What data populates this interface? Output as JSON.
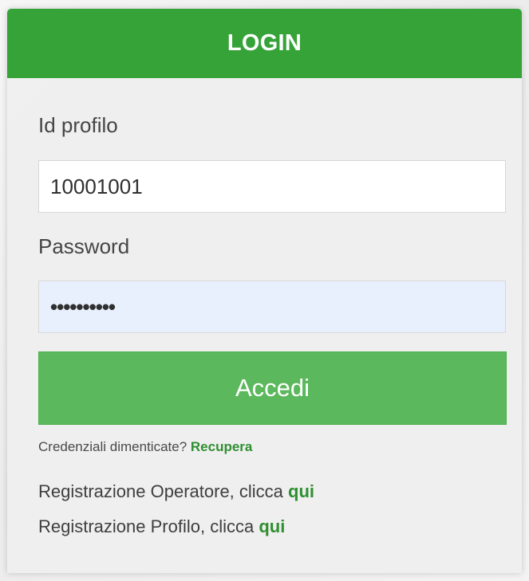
{
  "login": {
    "title": "LOGIN",
    "id_label": "Id profilo",
    "id_value": "10001001",
    "password_label": "Password",
    "password_value": "••••••••••",
    "submit_label": "Accedi",
    "forgot_text": "Credenziali dimenticate?",
    "forgot_link": "Recupera",
    "operator_text": "Registrazione Operatore, clicca",
    "operator_link": "qui",
    "profile_text": "Registrazione Profilo, clicca",
    "profile_link": "qui"
  },
  "colors": {
    "header": "#35a338",
    "button": "#5cb85c",
    "link": "#2f8f31"
  }
}
